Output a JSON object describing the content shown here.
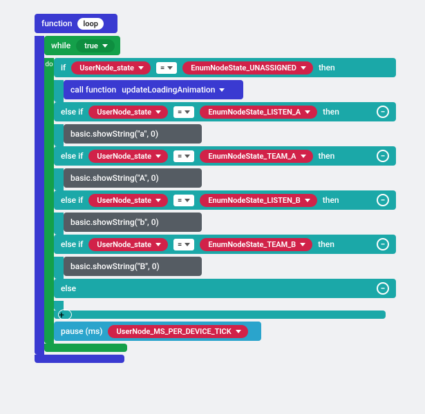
{
  "function": {
    "label": "function",
    "name": "loop"
  },
  "while": {
    "label": "while",
    "cond": "true",
    "do": "do"
  },
  "branches": [
    {
      "kw": "if",
      "lhs": "UserNode_state",
      "op": "=",
      "rhs": "EnumNodeState_UNASSIGNED",
      "then": "then",
      "call_label": "call function",
      "call_fn": "updateLoadingAnimation"
    },
    {
      "kw": "else if",
      "lhs": "UserNode_state",
      "op": "=",
      "rhs": "EnumNodeState_LISTEN_A",
      "then": "then",
      "stmt": "basic.showString(\"a\", 0)"
    },
    {
      "kw": "else if",
      "lhs": "UserNode_state",
      "op": "=",
      "rhs": "EnumNodeState_TEAM_A",
      "then": "then",
      "stmt": "basic.showString(\"A\", 0)"
    },
    {
      "kw": "else if",
      "lhs": "UserNode_state",
      "op": "=",
      "rhs": "EnumNodeState_LISTEN_B",
      "then": "then",
      "stmt": "basic.showString(\"b\", 0)"
    },
    {
      "kw": "else if",
      "lhs": "UserNode_state",
      "op": "=",
      "rhs": "EnumNodeState_TEAM_B",
      "then": "then",
      "stmt": "basic.showString(\"B\", 0)"
    }
  ],
  "else": {
    "kw": "else"
  },
  "plus": "+",
  "pause": {
    "label": "pause (ms)",
    "arg": "UserNode_MS_PER_DEVICE_TICK"
  },
  "minus": "−"
}
